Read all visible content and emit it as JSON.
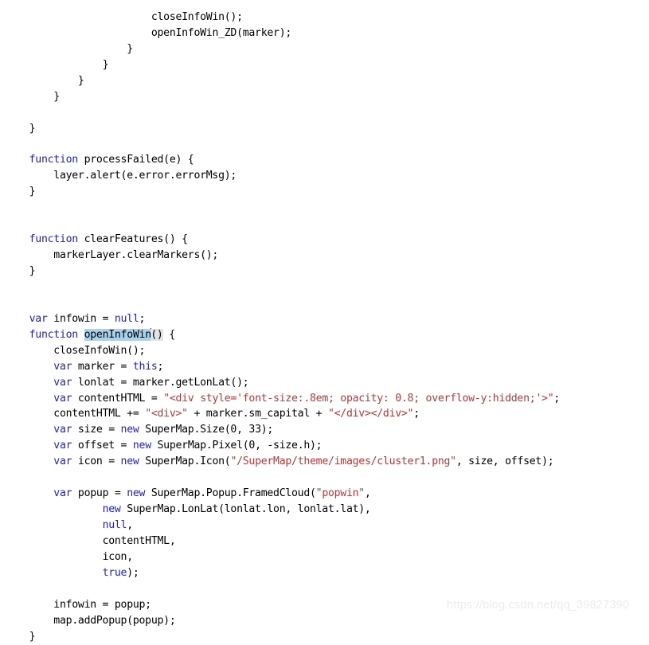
{
  "editor": {
    "language": "javascript",
    "background_color": "#ffffff",
    "keyword_color": "#2121c4",
    "string_color": "#b03a3a",
    "text_color": "#000000",
    "selection_color": "#a9d2ee",
    "bracket_highlight_color": "#dfe4e6",
    "caret_after_token": "openInfoWin",
    "selected_text": "openInfoWin",
    "lines": [
      {
        "indent": 24,
        "tokens": [
          {
            "t": "closeInfoWin();",
            "c": "plain"
          }
        ]
      },
      {
        "indent": 24,
        "tokens": [
          {
            "t": "openInfoWin_ZD(marker);",
            "c": "plain"
          }
        ]
      },
      {
        "indent": 20,
        "tokens": [
          {
            "t": "}",
            "c": "plain"
          }
        ]
      },
      {
        "indent": 16,
        "tokens": [
          {
            "t": "}",
            "c": "plain"
          }
        ]
      },
      {
        "indent": 12,
        "tokens": [
          {
            "t": "}",
            "c": "plain"
          }
        ]
      },
      {
        "indent": 8,
        "tokens": [
          {
            "t": "}",
            "c": "plain"
          }
        ]
      },
      {
        "indent": 0,
        "tokens": []
      },
      {
        "indent": 4,
        "tokens": [
          {
            "t": "}",
            "c": "plain"
          }
        ]
      },
      {
        "indent": 0,
        "tokens": []
      },
      {
        "indent": 4,
        "tokens": [
          {
            "t": "function",
            "c": "kw"
          },
          {
            "t": " processFailed(e) {",
            "c": "plain"
          }
        ]
      },
      {
        "indent": 8,
        "tokens": [
          {
            "t": "layer.alert(e.error.errorMsg);",
            "c": "plain"
          }
        ]
      },
      {
        "indent": 4,
        "tokens": [
          {
            "t": "}",
            "c": "plain"
          }
        ]
      },
      {
        "indent": 0,
        "tokens": []
      },
      {
        "indent": 0,
        "tokens": []
      },
      {
        "indent": 4,
        "tokens": [
          {
            "t": "function",
            "c": "kw"
          },
          {
            "t": " clearFeatures() {",
            "c": "plain"
          }
        ]
      },
      {
        "indent": 8,
        "tokens": [
          {
            "t": "markerLayer.clearMarkers();",
            "c": "plain"
          }
        ]
      },
      {
        "indent": 4,
        "tokens": [
          {
            "t": "}",
            "c": "plain"
          }
        ]
      },
      {
        "indent": 0,
        "tokens": []
      },
      {
        "indent": 0,
        "tokens": []
      },
      {
        "indent": 4,
        "tokens": [
          {
            "t": "var",
            "c": "kw"
          },
          {
            "t": " infowin = ",
            "c": "plain"
          },
          {
            "t": "null",
            "c": "kw"
          },
          {
            "t": ";",
            "c": "plain"
          }
        ]
      },
      {
        "indent": 4,
        "tokens": [
          {
            "t": "function",
            "c": "kw"
          },
          {
            "t": " ",
            "c": "plain"
          },
          {
            "t": "openInfoWin",
            "c": "sel"
          },
          {
            "t": "",
            "c": "caret"
          },
          {
            "t": "()",
            "c": "bracket-hl"
          },
          {
            "t": " {",
            "c": "plain"
          }
        ]
      },
      {
        "indent": 8,
        "tokens": [
          {
            "t": "closeInfoWin();",
            "c": "plain"
          }
        ]
      },
      {
        "indent": 8,
        "tokens": [
          {
            "t": "var",
            "c": "kw"
          },
          {
            "t": " marker = ",
            "c": "plain"
          },
          {
            "t": "this",
            "c": "kw"
          },
          {
            "t": ";",
            "c": "plain"
          }
        ]
      },
      {
        "indent": 8,
        "tokens": [
          {
            "t": "var",
            "c": "kw"
          },
          {
            "t": " lonlat = marker.getLonLat();",
            "c": "plain"
          }
        ]
      },
      {
        "indent": 8,
        "tokens": [
          {
            "t": "var",
            "c": "kw"
          },
          {
            "t": " contentHTML = ",
            "c": "plain"
          },
          {
            "t": "\"<div style='font-size:.8em; opacity: 0.8; overflow-y:hidden;'>\"",
            "c": "str"
          },
          {
            "t": ";",
            "c": "plain"
          }
        ]
      },
      {
        "indent": 8,
        "tokens": [
          {
            "t": "contentHTML += ",
            "c": "plain"
          },
          {
            "t": "\"<div>\"",
            "c": "str"
          },
          {
            "t": " + marker.sm_capital + ",
            "c": "plain"
          },
          {
            "t": "\"</div></div>\"",
            "c": "str"
          },
          {
            "t": ";",
            "c": "plain"
          }
        ]
      },
      {
        "indent": 8,
        "tokens": [
          {
            "t": "var",
            "c": "kw"
          },
          {
            "t": " size = ",
            "c": "plain"
          },
          {
            "t": "new",
            "c": "kw"
          },
          {
            "t": " SuperMap.Size(0, 33);",
            "c": "plain"
          }
        ]
      },
      {
        "indent": 8,
        "tokens": [
          {
            "t": "var",
            "c": "kw"
          },
          {
            "t": " offset = ",
            "c": "plain"
          },
          {
            "t": "new",
            "c": "kw"
          },
          {
            "t": " SuperMap.Pixel(0, -size.h);",
            "c": "plain"
          }
        ]
      },
      {
        "indent": 8,
        "tokens": [
          {
            "t": "var",
            "c": "kw"
          },
          {
            "t": " icon = ",
            "c": "plain"
          },
          {
            "t": "new",
            "c": "kw"
          },
          {
            "t": " SuperMap.Icon(",
            "c": "plain"
          },
          {
            "t": "\"/SuperMap/theme/images/cluster1.png\"",
            "c": "str"
          },
          {
            "t": ", size, offset);",
            "c": "plain"
          }
        ]
      },
      {
        "indent": 0,
        "tokens": []
      },
      {
        "indent": 8,
        "tokens": [
          {
            "t": "var",
            "c": "kw"
          },
          {
            "t": " popup = ",
            "c": "plain"
          },
          {
            "t": "new",
            "c": "kw"
          },
          {
            "t": " SuperMap.Popup.FramedCloud(",
            "c": "plain"
          },
          {
            "t": "\"popwin\"",
            "c": "str"
          },
          {
            "t": ",",
            "c": "plain"
          }
        ]
      },
      {
        "indent": 16,
        "tokens": [
          {
            "t": "new",
            "c": "kw"
          },
          {
            "t": " SuperMap.LonLat(lonlat.lon, lonlat.lat),",
            "c": "plain"
          }
        ]
      },
      {
        "indent": 16,
        "tokens": [
          {
            "t": "null",
            "c": "kw"
          },
          {
            "t": ",",
            "c": "plain"
          }
        ]
      },
      {
        "indent": 16,
        "tokens": [
          {
            "t": "contentHTML,",
            "c": "plain"
          }
        ]
      },
      {
        "indent": 16,
        "tokens": [
          {
            "t": "icon,",
            "c": "plain"
          }
        ]
      },
      {
        "indent": 16,
        "tokens": [
          {
            "t": "true",
            "c": "kw"
          },
          {
            "t": ");",
            "c": "plain"
          }
        ]
      },
      {
        "indent": 0,
        "tokens": []
      },
      {
        "indent": 8,
        "tokens": [
          {
            "t": "infowin = popup;",
            "c": "plain"
          }
        ]
      },
      {
        "indent": 8,
        "tokens": [
          {
            "t": "map.addPopup(popup);",
            "c": "plain"
          }
        ]
      },
      {
        "indent": 4,
        "tokens": [
          {
            "t": "}",
            "c": "plain"
          }
        ]
      }
    ]
  },
  "watermark": {
    "text": "https://blog.csdn.net/qq_39827390"
  }
}
